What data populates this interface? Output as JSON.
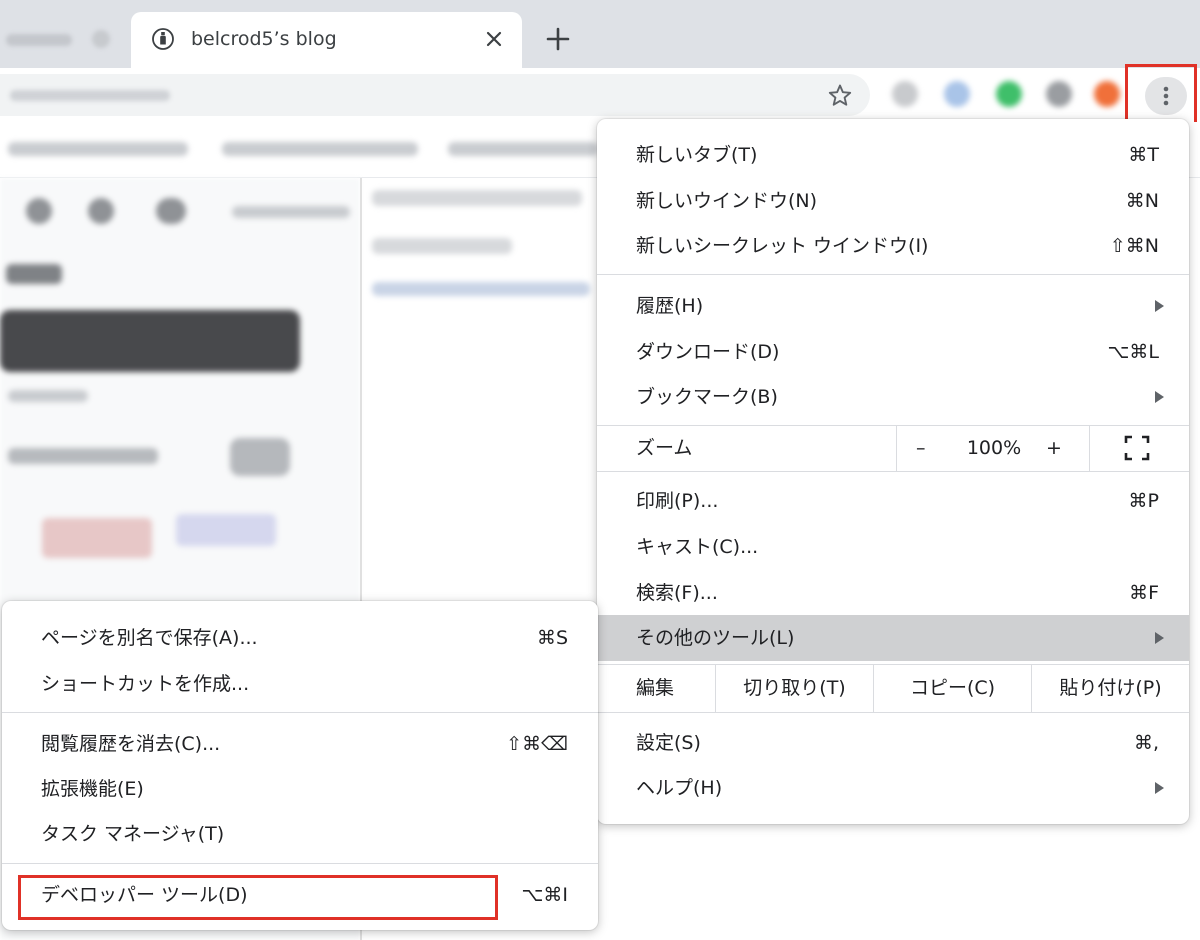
{
  "tabs": {
    "active_title": "belcrod5’s blog"
  },
  "colors": {
    "highlight": "#e03127",
    "menu_hover": "#cfd0d2",
    "tabstrip": "#dee1e6"
  },
  "icons": {
    "favicon": "bottle-favicon-icon",
    "tab_close": "close-icon",
    "new_tab": "plus-icon",
    "bookmark": "star-icon",
    "menu": "kebab-menu-icon",
    "submenu_arrow": "chevron-right-icon",
    "fullscreen": "fullscreen-icon"
  },
  "main_menu": {
    "new_tab": {
      "label": "新しいタブ(T)",
      "shortcut": "⌘T"
    },
    "new_window": {
      "label": "新しいウインドウ(N)",
      "shortcut": "⌘N"
    },
    "new_incognito": {
      "label": "新しいシークレット ウインドウ(I)",
      "shortcut": "⇧⌘N"
    },
    "history": {
      "label": "履歴(H)"
    },
    "downloads": {
      "label": "ダウンロード(D)",
      "shortcut": "⌥⌘L"
    },
    "bookmarks": {
      "label": "ブックマーク(B)"
    },
    "zoom": {
      "label": "ズーム",
      "minus": "–",
      "value": "100%",
      "plus": "+"
    },
    "print": {
      "label": "印刷(P)...",
      "shortcut": "⌘P"
    },
    "cast": {
      "label": "キャスト(C)..."
    },
    "find": {
      "label": "検索(F)...",
      "shortcut": "⌘F"
    },
    "more_tools": {
      "label": "その他のツール(L)"
    },
    "edit": {
      "label": "編集",
      "cut": "切り取り(T)",
      "copy": "コピー(C)",
      "paste": "貼り付け(P)"
    },
    "settings": {
      "label": "設定(S)",
      "shortcut": "⌘,"
    },
    "help": {
      "label": "ヘルプ(H)"
    }
  },
  "sub_menu": {
    "save_page": {
      "label": "ページを別名で保存(A)...",
      "shortcut": "⌘S"
    },
    "create_shortcut": {
      "label": "ショートカットを作成..."
    },
    "clear_data": {
      "label": "閲覧履歴を消去(C)...",
      "shortcut": "⇧⌘⌫"
    },
    "extensions": {
      "label": "拡張機能(E)"
    },
    "task_manager": {
      "label": "タスク マネージャ(T)"
    },
    "dev_tools": {
      "label": "デベロッパー ツール(D)",
      "shortcut": "⌥⌘I"
    }
  }
}
